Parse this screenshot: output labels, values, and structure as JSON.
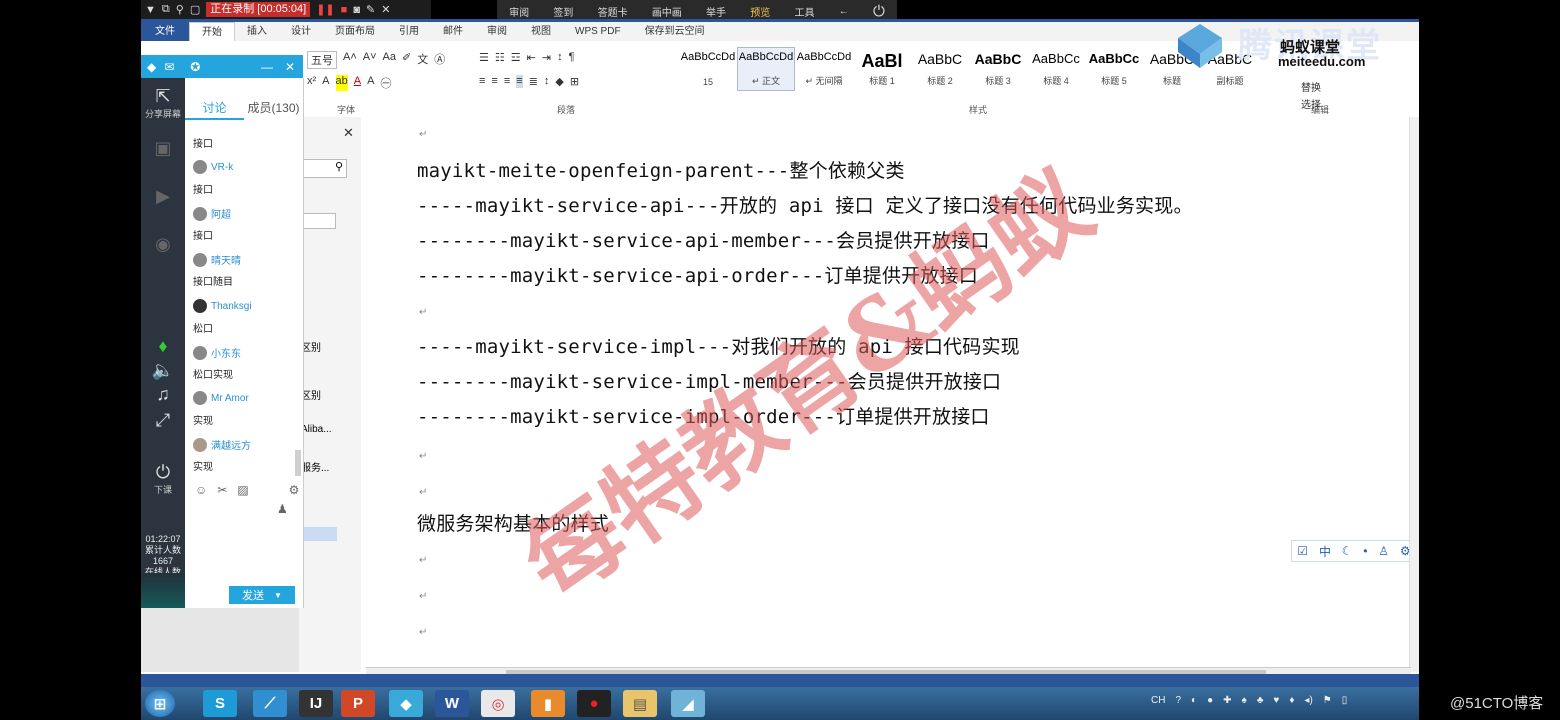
{
  "recording_bar": {
    "status": "正在录制 [00:05:04]"
  },
  "float_toolbar": {
    "items": [
      "审阅",
      "签到",
      "答题卡",
      "画中画",
      "举手",
      "预览",
      "工具"
    ]
  },
  "ribbon": {
    "tabs": [
      "文件",
      "开始",
      "插入",
      "设计",
      "页面布局",
      "引用",
      "邮件",
      "审阅",
      "视图",
      "WPS PDF",
      "保存到云空间"
    ],
    "font_size": "五号",
    "group_labels": {
      "font": "字体",
      "paragraph": "段落",
      "styles": "样式",
      "edit": "编辑"
    },
    "styles": [
      {
        "preview": "AaBbCcDd",
        "name": "15"
      },
      {
        "preview": "AaBbCcDd",
        "name": "↵ 正文"
      },
      {
        "preview": "AaBbCcDd",
        "name": "↵ 无间隔"
      },
      {
        "preview": "AaBl",
        "name": "标题 1"
      },
      {
        "preview": "AaBbC",
        "name": "标题 2"
      },
      {
        "preview": "AaBbC",
        "name": "标题 3"
      },
      {
        "preview": "AaBbCc",
        "name": "标题 4"
      },
      {
        "preview": "AaBbCc",
        "name": "标题 5"
      },
      {
        "preview": "AaBbC",
        "name": "标题"
      },
      {
        "preview": "AaBbC",
        "name": "副标题"
      }
    ],
    "edit_items": [
      "替换",
      "选择"
    ]
  },
  "nav_pane": {
    "fragments": [
      "区别",
      "区别",
      "Aliba...",
      "服务..."
    ]
  },
  "document": {
    "lines": [
      "mayikt-meite-openfeign-parent---整个依赖父类",
      "-----mayikt-service-api---开放的 api 接口 定义了接口没有任何代码业务实现。",
      "--------mayikt-service-api-member---会员提供开放接口",
      "--------mayikt-service-api-order---订单提供开放接口",
      "-----mayikt-service-impl---对我们开放的 api 接口代码实现",
      "--------mayikt-service-impl-member---会员提供开放接口",
      "--------mayikt-service-impl-order---订单提供开放接口"
    ],
    "heading": "微服务架构基本的样式",
    "watermark": "每特教育&蚂蚁"
  },
  "ime_bar": {
    "mode": "中"
  },
  "chat": {
    "tabs": [
      "讨论",
      "成员(130)"
    ],
    "messages": [
      {
        "name": "",
        "text": "接口"
      },
      {
        "name": "VR-k",
        "text": "接口"
      },
      {
        "name": "阿超",
        "text": "接口"
      },
      {
        "name": "晴天晴",
        "text": "接口随目"
      },
      {
        "name": "Thanksgi",
        "text": "松口"
      },
      {
        "name": "小东东",
        "text": "松口实现"
      },
      {
        "name": "Mr Amor",
        "text": "实现"
      },
      {
        "name": "满越远方",
        "text": "实现"
      }
    ],
    "send_label": "发送"
  },
  "class_sidebar": {
    "share_label": "分享屏幕",
    "download_label": "下课",
    "clock": "01:22:07",
    "stats": [
      "累计人数",
      "1667",
      "在线人数"
    ]
  },
  "logo": {
    "text": "腾讯课堂",
    "brand": "蚂蚁课堂",
    "site": "meiteedu.com"
  },
  "taskbar": {
    "apps": [
      "S",
      "⟋",
      "IJ",
      "P",
      "◆",
      "W",
      "◎",
      "▮",
      "●",
      "▤",
      "◢"
    ],
    "lang": "CH"
  },
  "credit": "@51CTO博客",
  "colors": {
    "word_blue": "#2b579a",
    "chat_blue": "#25a5dd",
    "watermark": "#dc5a5a"
  }
}
